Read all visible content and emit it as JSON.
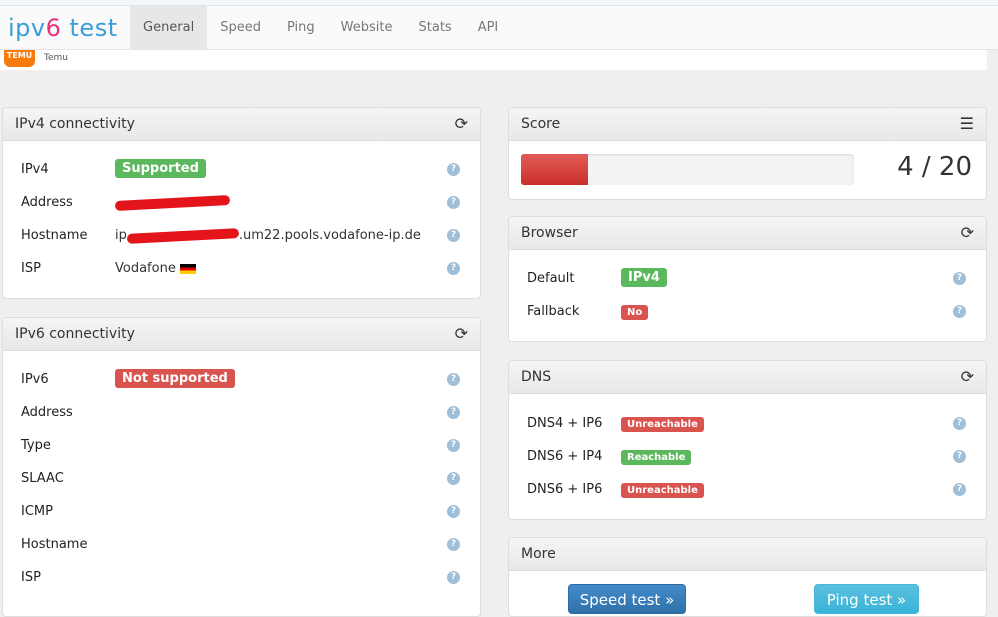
{
  "header": {
    "logo_a": "ipv",
    "logo_b": "6",
    "logo_c": " test",
    "tabs": [
      "General",
      "Speed",
      "Ping",
      "Website",
      "Stats",
      "API"
    ],
    "active_tab": "General"
  },
  "ad": {
    "badge": "TEMU",
    "text": "Temu"
  },
  "ipv4": {
    "title": "IPv4 connectivity",
    "rows": [
      {
        "label": "IPv4",
        "value": "Supported"
      },
      {
        "label": "Address",
        "value": ""
      },
      {
        "label": "Hostname",
        "value_prefix": "ip",
        "value_suffix": ".um22.pools.vodafone-ip.de"
      },
      {
        "label": "ISP",
        "value": "Vodafone"
      }
    ]
  },
  "ipv6": {
    "title": "IPv6 connectivity",
    "rows": [
      {
        "label": "IPv6",
        "value": "Not supported"
      },
      {
        "label": "Address"
      },
      {
        "label": "Type"
      },
      {
        "label": "SLAAC"
      },
      {
        "label": "ICMP"
      },
      {
        "label": "Hostname"
      },
      {
        "label": "ISP"
      }
    ]
  },
  "score": {
    "title": "Score",
    "value": 4,
    "max": 20,
    "text": "4 / 20",
    "fraction": 0.2
  },
  "browser": {
    "title": "Browser",
    "rows": [
      {
        "label": "Default",
        "value": "IPv4"
      },
      {
        "label": "Fallback",
        "value": "No"
      }
    ]
  },
  "dns": {
    "title": "DNS",
    "rows": [
      {
        "label": "DNS4 + IP6",
        "value": "Unreachable"
      },
      {
        "label": "DNS6 + IP4",
        "value": "Reachable"
      },
      {
        "label": "DNS6 + IP6",
        "value": "Unreachable"
      }
    ]
  },
  "more": {
    "title": "More",
    "speed_button": "Speed test »",
    "ping_button": "Ping test »"
  },
  "help": "?"
}
